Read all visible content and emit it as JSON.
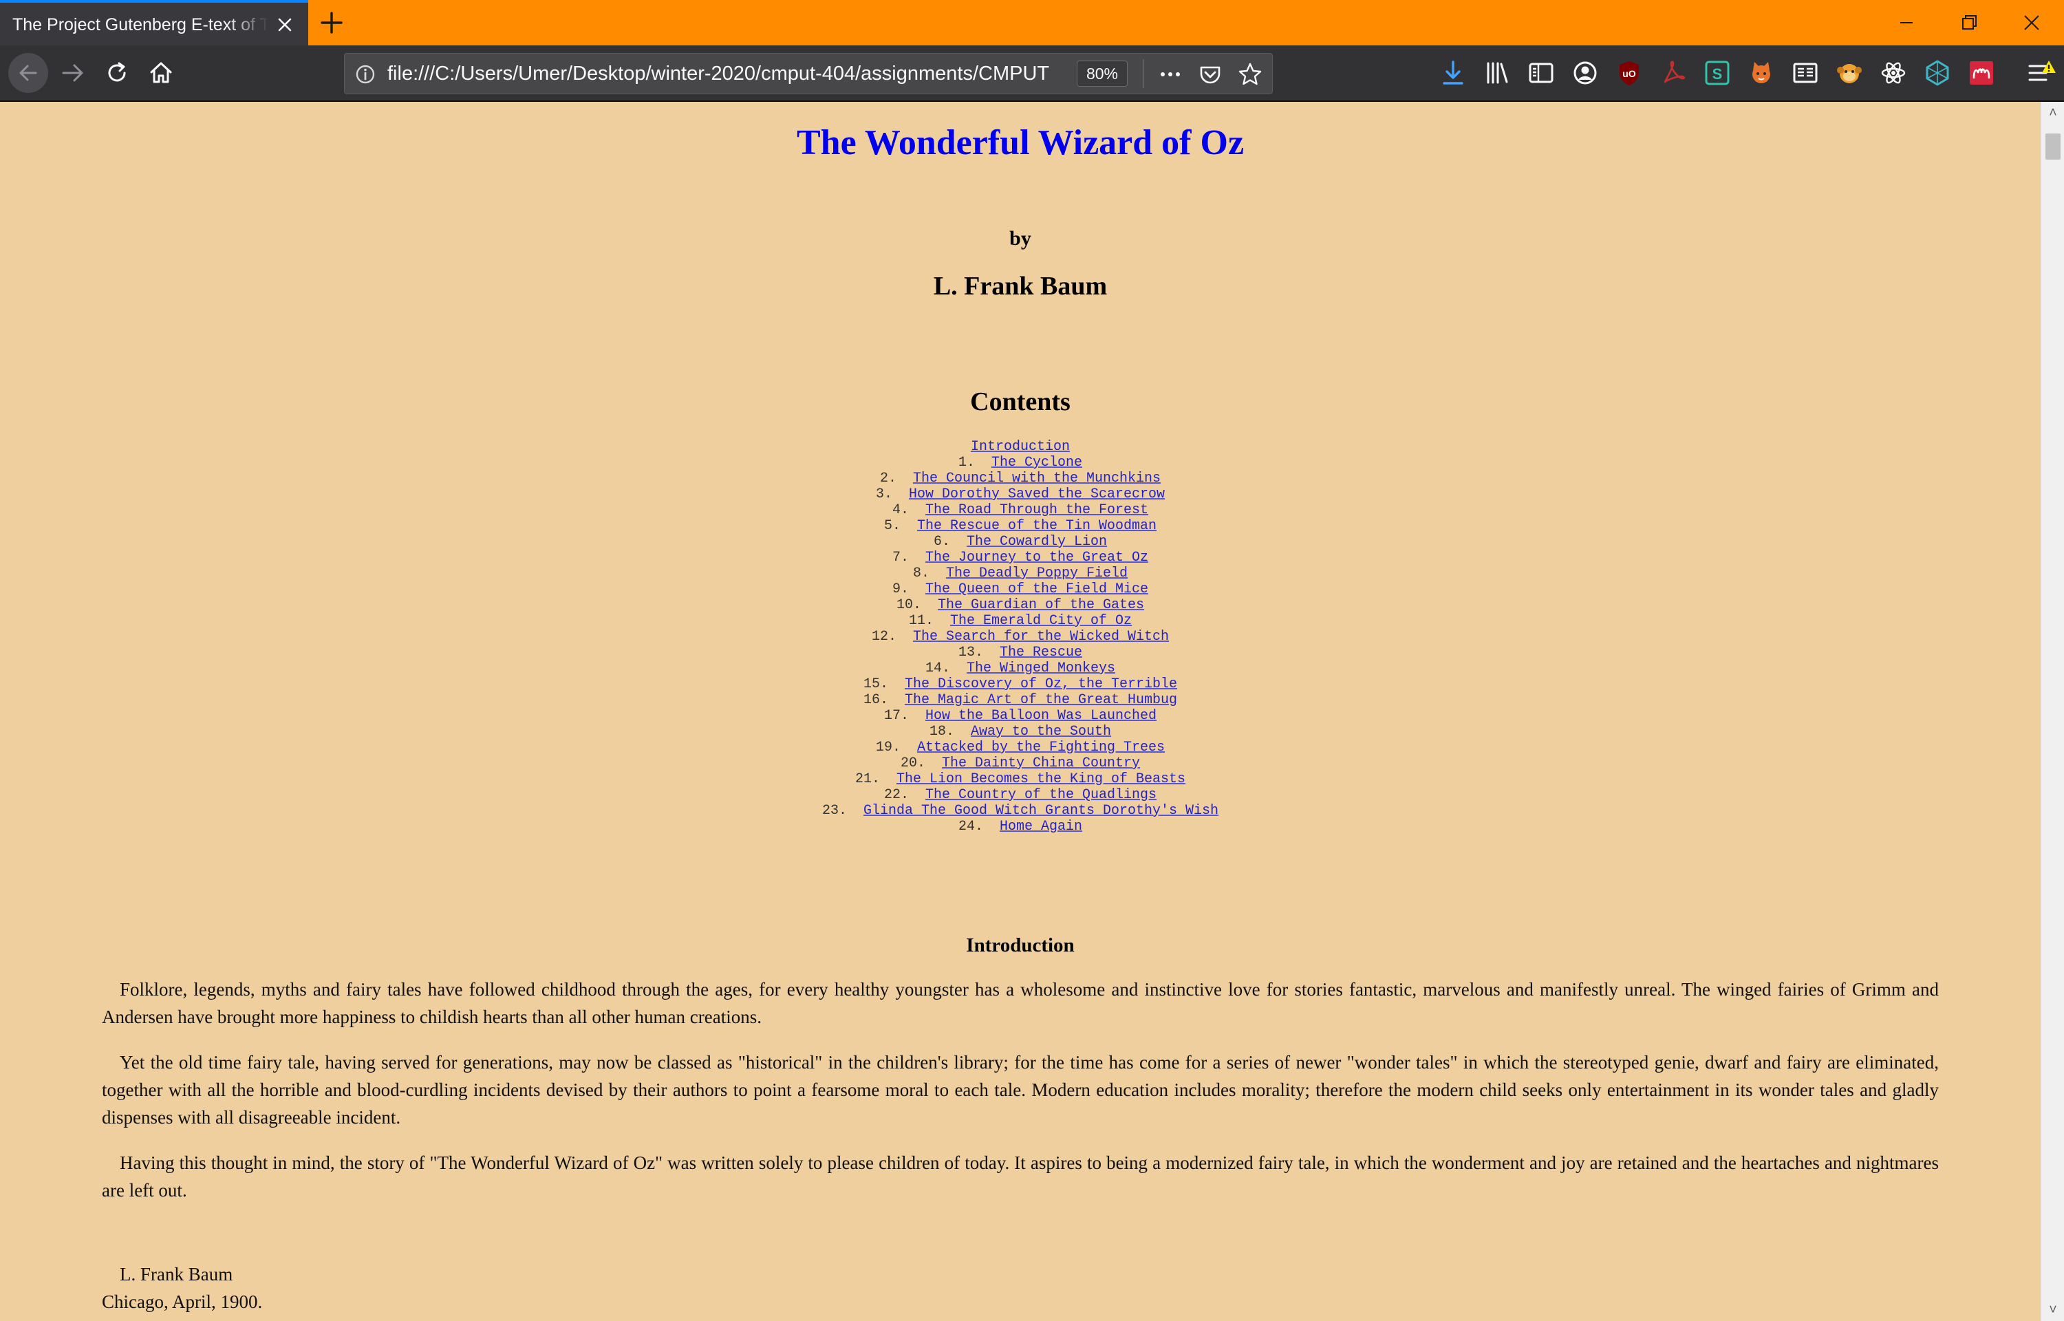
{
  "browser": {
    "tab_title": "The Project Gutenberg E-text of The Wonderful Wizard of Oz",
    "url": "file:///C:/Users/Umer/Desktop/winter-2020/cmput-404/assignments/CMPUT",
    "zoom_label": "80%"
  },
  "colors": {
    "tabstrip": "#ff8c00",
    "toolbar": "#323234",
    "page_background": "#f0cf9e",
    "title_link": "#0000ee",
    "toc_link": "#2222cc"
  },
  "icons": {
    "toolbar": [
      "download-icon",
      "library-icon",
      "sidebar-icon",
      "account-icon",
      "ublock-icon",
      "pdf-icon",
      "s-extension-icon",
      "fox-extension-icon",
      "reader-icon",
      "monkey-extension-icon",
      "react-devtools-icon",
      "web-extension-icon",
      "mendeley-icon",
      "menu-icon"
    ]
  },
  "page": {
    "title": "The Wonderful Wizard of Oz",
    "by": "by",
    "author": "L. Frank Baum",
    "contents_heading": "Contents",
    "toc": [
      {
        "num": "",
        "label": "Introduction"
      },
      {
        "num": "1.",
        "label": "The Cyclone"
      },
      {
        "num": "2.",
        "label": "The Council with the Munchkins"
      },
      {
        "num": "3.",
        "label": "How Dorothy Saved the Scarecrow"
      },
      {
        "num": "4.",
        "label": "The Road Through the Forest"
      },
      {
        "num": "5.",
        "label": "The Rescue of the Tin Woodman"
      },
      {
        "num": "6.",
        "label": "The Cowardly Lion"
      },
      {
        "num": "7.",
        "label": "The Journey to the Great Oz"
      },
      {
        "num": "8.",
        "label": "The Deadly Poppy Field"
      },
      {
        "num": "9.",
        "label": "The Queen of the Field Mice"
      },
      {
        "num": "10.",
        "label": "The Guardian of the Gates"
      },
      {
        "num": "11.",
        "label": "The Emerald City of Oz"
      },
      {
        "num": "12.",
        "label": "The Search for the Wicked Witch"
      },
      {
        "num": "13.",
        "label": "The Rescue"
      },
      {
        "num": "14.",
        "label": "The Winged Monkeys"
      },
      {
        "num": "15.",
        "label": "The Discovery of Oz, the Terrible"
      },
      {
        "num": "16.",
        "label": "The Magic Art of the Great Humbug"
      },
      {
        "num": "17.",
        "label": "How the Balloon Was Launched"
      },
      {
        "num": "18.",
        "label": "Away to the South"
      },
      {
        "num": "19.",
        "label": "Attacked by the Fighting Trees"
      },
      {
        "num": "20.",
        "label": "The Dainty China Country"
      },
      {
        "num": "21.",
        "label": "The Lion Becomes the King of Beasts"
      },
      {
        "num": "22.",
        "label": "The Country of the Quadlings"
      },
      {
        "num": "23.",
        "label": "Glinda The Good Witch Grants Dorothy's Wish"
      },
      {
        "num": "24.",
        "label": "Home Again"
      }
    ],
    "intro_heading": "Introduction",
    "paragraphs": [
      "Folklore, legends, myths and fairy tales have followed childhood through the ages, for every healthy youngster has a wholesome and instinctive love for stories fantastic, marvelous and manifestly unreal. The winged fairies of Grimm and Andersen have brought more happiness to childish hearts than all other human creations.",
      "Yet the old time fairy tale, having served for generations, may now be classed as \"historical\" in the children's library; for the time has come for a series of newer \"wonder tales\" in which the stereotyped genie, dwarf and fairy are eliminated, together with all the horrible and blood-curdling incidents devised by their authors to point a fearsome moral to each tale. Modern education includes morality; therefore the modern child seeks only entertainment in its wonder tales and gladly dispenses with all disagreeable incident.",
      "Having this thought in mind, the story of \"The Wonderful Wizard of Oz\" was written solely to please children of today. It aspires to being a modernized fairy tale, in which the wonderment and joy are retained and the heartaches and nightmares are left out."
    ],
    "signature_name": "L. Frank Baum",
    "signature_place": "Chicago, April, 1900."
  }
}
